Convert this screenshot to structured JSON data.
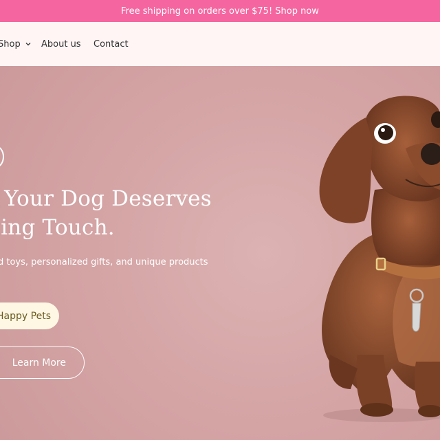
{
  "announcement": {
    "text": "Free shipping on orders over $75! Shop now"
  },
  "nav": {
    "items": [
      {
        "label": "Shop",
        "has_dropdown": true
      },
      {
        "label": "About us"
      },
      {
        "label": "Contact"
      }
    ]
  },
  "hero": {
    "title_line1": "g Your Dog Deserves",
    "title_line2": "rling Touch.",
    "subtitle": "d toys, personalized gifts, and unique products",
    "primary_button": "Happy Pets",
    "secondary_button": "Learn More",
    "image_alt": "dachshund-puppy"
  },
  "colors": {
    "announcement_bg": "#f566a0",
    "nav_bg": "#fff5f5",
    "hero_bg": "#d4a3a4",
    "primary_button_bg": "#fdf7e4",
    "primary_button_text": "#6b5a1d",
    "dog_fur": "#8a4a2c"
  }
}
